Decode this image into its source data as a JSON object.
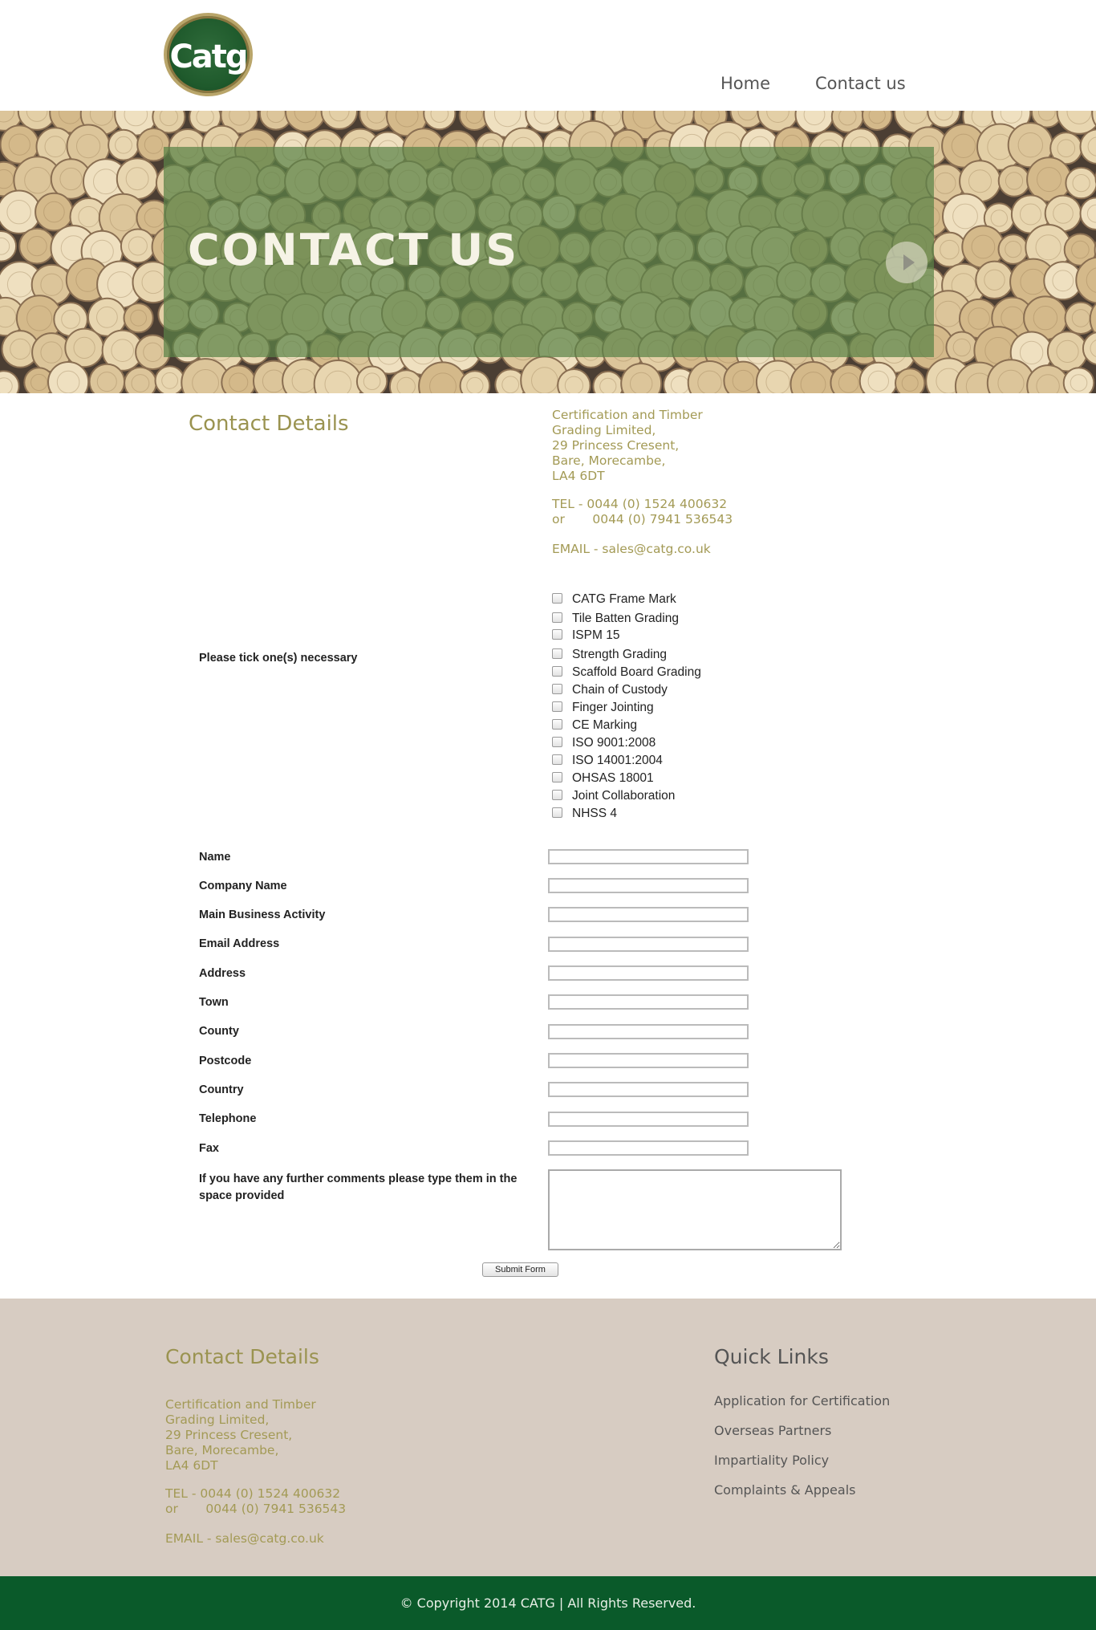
{
  "brand": {
    "logo_text": "Catg"
  },
  "nav": {
    "home": "Home",
    "contact": "Contact us"
  },
  "hero": {
    "title": "CONTACT US"
  },
  "contact": {
    "heading": "Contact Details",
    "address_lines": [
      "Certification and Timber",
      "Grading Limited,",
      "29 Princess Cresent,",
      "Bare, Morecambe,",
      "LA4 6DT"
    ],
    "tel_lines": [
      "TEL - 0044 (0) 1524 400632",
      "or       0044 (0) 7941 536543"
    ],
    "email": "EMAIL -  sales@catg.co.uk"
  },
  "form": {
    "tick_label": "Please tick one(s) necessary",
    "checkboxes": [
      "CATG Frame Mark",
      "Tile Batten Grading",
      "ISPM 15",
      "Strength Grading",
      "Scaffold Board Grading",
      "Chain of Custody",
      "Finger Jointing",
      "CE Marking",
      "ISO 9001:2008",
      "ISO 14001:2004",
      "OHSAS 18001",
      "Joint Collaboration",
      "NHSS 4"
    ],
    "fields": [
      "Name",
      "Company Name",
      "Main Business Activity",
      "Email Address",
      "Address",
      "Town",
      "County",
      "Postcode",
      "Country",
      "Telephone",
      "Fax"
    ],
    "comments_label": "If you have any further comments please type them in the space provided",
    "submit_label": "Submit Form"
  },
  "footer": {
    "contact_heading": "Contact Details",
    "address_lines": [
      "Certification and Timber",
      "Grading Limited,",
      "29 Princess Cresent,",
      "Bare, Morecambe,",
      "LA4 6DT"
    ],
    "tel_lines": [
      "TEL - 0044 (0) 1524 400632",
      "or       0044 (0) 7941 536543"
    ],
    "email": "EMAIL -  sales@catg.co.uk",
    "quick_links_heading": "Quick Links",
    "quick_links": [
      "Application for Certification",
      "Overseas Partners",
      "Impartiality Policy",
      "Complaints & Appeals"
    ],
    "copyright": "© Copyright 2014 CATG |  All Rights Reserved."
  },
  "colors": {
    "accent_olive": "#a39a55",
    "footer_bg": "#d7ccc2",
    "copyright_bg": "#0a5a2a",
    "hero_overlay": "#5a8246"
  }
}
